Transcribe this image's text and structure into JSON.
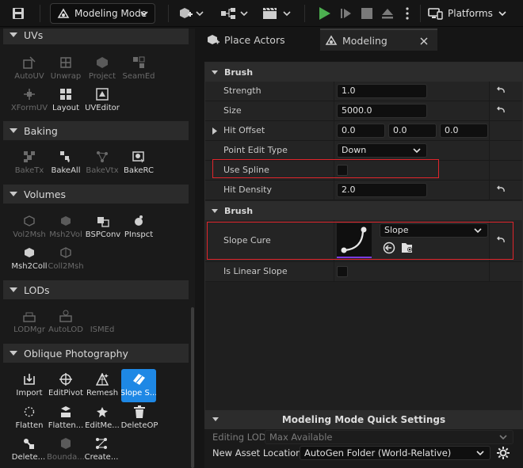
{
  "toolbar": {
    "mode_label": "Modeling Mode",
    "platforms_label": "Platforms"
  },
  "left": {
    "categories": [
      {
        "label": "UVs"
      },
      {
        "label": "Baking"
      },
      {
        "label": "Volumes"
      },
      {
        "label": "LODs"
      },
      {
        "label": "Oblique Photography"
      }
    ],
    "uvs": [
      "AutoUV",
      "Unwrap",
      "Project",
      "SeamEd",
      "XFormUV",
      "Layout",
      "UVEditor"
    ],
    "baking": [
      "BakeTx",
      "BakeAll",
      "BakeVtx",
      "BakeRC"
    ],
    "volumes": [
      "Vol2Msh",
      "Msh2Vol",
      "BSPConv",
      "PInspct",
      "Msh2Coll",
      "Coll2Msh"
    ],
    "lods": [
      "LODMgr",
      "AutoLOD",
      "ISMEd"
    ],
    "oblique": [
      "Import",
      "EditPivot",
      "Remesh",
      "Slope S...",
      "Flatten",
      "Flatten...",
      "EditMe...",
      "DeleteOP",
      "Delete...",
      "Bounda...",
      "Create..."
    ]
  },
  "tabs": {
    "place_actors": "Place Actors",
    "modeling": "Modeling"
  },
  "details": {
    "section1": "Brush",
    "strength_label": "Strength",
    "strength_value": "1.0",
    "size_label": "Size",
    "size_value": "5000.0",
    "hit_offset_label": "Hit Offset",
    "hit_offset_x": "0.0",
    "hit_offset_y": "0.0",
    "hit_offset_z": "0.0",
    "point_edit_label": "Point Edit Type",
    "point_edit_value": "Down",
    "use_spline_label": "Use Spline",
    "hit_density_label": "Hit Density",
    "hit_density_value": "2.0",
    "section2": "Brush",
    "slope_curve_label": "Slope Cure",
    "slope_curve_value": "Slope",
    "linear_slope_label": "Is Linear Slope"
  },
  "quick": {
    "title": "Modeling Mode Quick Settings",
    "editing_lod_label": "Editing LOD",
    "editing_lod_value": "Max Available",
    "new_asset_label": "New Asset Location",
    "new_asset_value": "AutoGen Folder (World-Relative)"
  },
  "colors": {
    "accent": "#1e88e5",
    "highlight": "#e0252c",
    "play": "#4caf50"
  }
}
